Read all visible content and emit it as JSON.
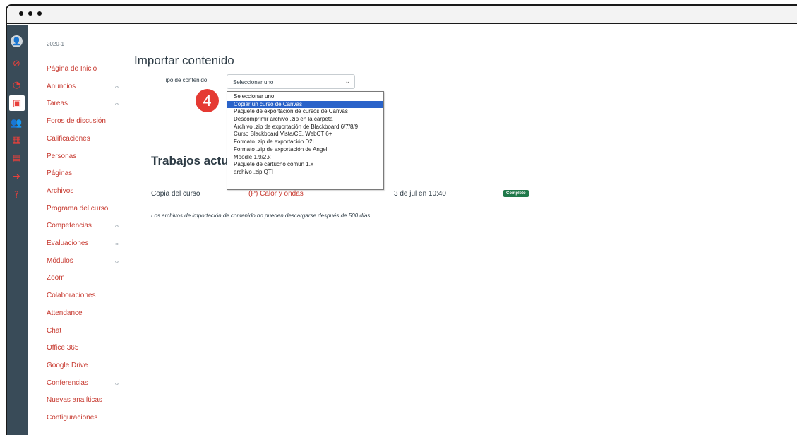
{
  "window": {
    "title_dots": 3
  },
  "rail": {
    "icons": [
      "avatar-icon",
      "account-icon",
      "dashboard-icon",
      "courses-icon",
      "groups-icon",
      "calendar-icon",
      "inbox-icon",
      "logout-icon",
      "help-icon"
    ],
    "glyphs": [
      "👤",
      "⊘",
      "◔",
      "▣",
      "👥",
      "▦",
      "▤",
      "➜",
      "?"
    ]
  },
  "course_nav": {
    "term": "2020-1",
    "items": [
      {
        "label": "Página de Inicio",
        "hidden": false
      },
      {
        "label": "Anuncios",
        "hidden": true
      },
      {
        "label": "Tareas",
        "hidden": true
      },
      {
        "label": "Foros de discusión",
        "hidden": false
      },
      {
        "label": "Calificaciones",
        "hidden": false
      },
      {
        "label": "Personas",
        "hidden": false
      },
      {
        "label": "Páginas",
        "hidden": false
      },
      {
        "label": "Archivos",
        "hidden": false
      },
      {
        "label": "Programa del curso",
        "hidden": false
      },
      {
        "label": "Competencias",
        "hidden": true
      },
      {
        "label": "Evaluaciones",
        "hidden": true
      },
      {
        "label": "Módulos",
        "hidden": true
      },
      {
        "label": "Zoom",
        "hidden": false
      },
      {
        "label": "Colaboraciones",
        "hidden": false
      },
      {
        "label": "Attendance",
        "hidden": false
      },
      {
        "label": "Chat",
        "hidden": false
      },
      {
        "label": "Office 365",
        "hidden": false
      },
      {
        "label": "Google Drive",
        "hidden": false
      },
      {
        "label": "Conferencias",
        "hidden": true
      },
      {
        "label": "Nuevas analíticas",
        "hidden": false
      },
      {
        "label": "Configuraciones",
        "hidden": false
      }
    ],
    "hidden_glyph": "ⴰ"
  },
  "import": {
    "title": "Importar contenido",
    "content_type_label": "Tipo de contenido",
    "select_value": "Seleccionar uno",
    "chevron": "⌄",
    "options": [
      "Seleccionar uno",
      "Copiar un curso de Canvas",
      "Paquete de exportación de cursos de Canvas",
      "Descomprimir archivo .zip en la carpeta",
      "Archivo .zip de exportación de Blackboard 6/7/8/9",
      "Curso Blackboard Vista/CE, WebCT 6+",
      "Formato .zip de exportación D2L",
      "Formato .zip de exportación de Angel",
      "Moodle 1.9/2.x",
      "Paquete de cartucho común 1.x",
      "archivo .zip QTI"
    ],
    "highlighted_index": 1
  },
  "step_badge": "4",
  "current_jobs": {
    "title": "Trabajos actu",
    "row": {
      "type": "Copia del curso",
      "source": "(P) Calor y ondas",
      "date": "3 de jul en 10:40",
      "status": "Completo"
    },
    "note": "Los archivos de importación de contenido no pueden descargarse después de 500 días."
  },
  "colors": {
    "accent": "#c7392f",
    "rail": "#394b58",
    "highlight": "#2a63c9",
    "badge": "#e53a33",
    "status": "#20794a"
  }
}
